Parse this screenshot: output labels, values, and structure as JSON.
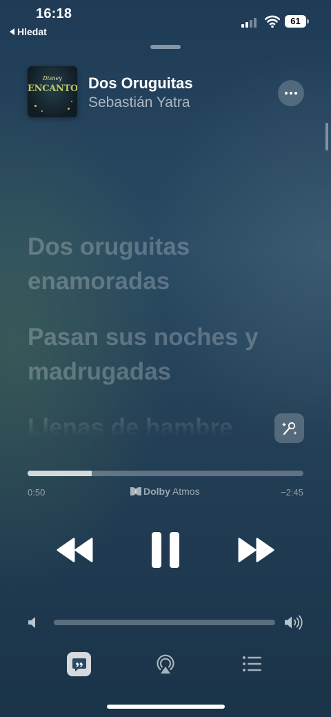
{
  "status_bar": {
    "time": "16:18",
    "back_label": "Hledat",
    "battery": "61"
  },
  "now_playing": {
    "album_brand": "Disney",
    "album_word": "ENCANTO",
    "title": "Dos Oruguitas",
    "artist": "Sebastián Yatra"
  },
  "lyrics": [
    "Dos oruguitas enamoradas",
    "Pasan sus noches y madrugadas",
    "Llenas de hambre"
  ],
  "playback": {
    "elapsed": "0:50",
    "remaining": "−2:45",
    "progress_fraction": 0.233,
    "dolby_brand": "Dolby",
    "dolby_suffix": "Atmos"
  },
  "volume": {
    "level_fraction": 0.0
  },
  "icons": {
    "more": "ellipsis-icon",
    "mic": "sing-mic-icon",
    "rewind": "backward-icon",
    "pause": "pause-icon",
    "forward": "forward-icon",
    "lyrics": "lyrics-quote-icon",
    "airplay": "airplay-icon",
    "queue": "queue-list-icon"
  },
  "colors": {
    "background_top": "#1f3b56",
    "background_bottom": "#1a3349"
  }
}
